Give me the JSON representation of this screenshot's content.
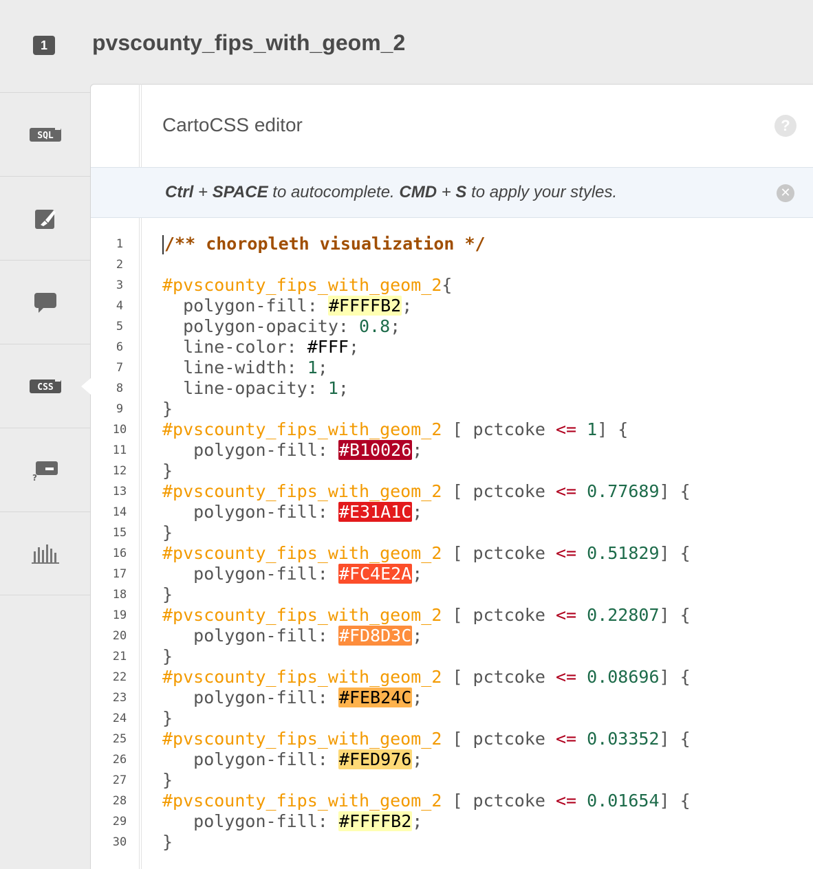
{
  "header": {
    "layer_number": "1",
    "layer_title": "pvscounty_fips_with_geom_2"
  },
  "sidebar": {
    "items": [
      {
        "name": "sql",
        "icon": "sql-icon",
        "label": "SQL"
      },
      {
        "name": "wizard",
        "icon": "paint-icon"
      },
      {
        "name": "infowindow",
        "icon": "speech-bubble-icon"
      },
      {
        "name": "css",
        "icon": "css-icon",
        "label": "CSS",
        "active": true
      },
      {
        "name": "legend",
        "icon": "legend-icon"
      },
      {
        "name": "filters",
        "icon": "bar-chart-icon"
      }
    ]
  },
  "editor": {
    "title": "CartoCSS editor",
    "hint": {
      "k1": "Ctrl",
      "plus1": " + ",
      "k2": "SPACE",
      "t1": " to autocomplete. ",
      "k3": "CMD",
      "plus2": " + ",
      "k4": "S",
      "t2": " to apply your styles."
    }
  },
  "code": {
    "selector": "#pvscounty_fips_with_geom_2",
    "comment": "/** choropleth visualization */",
    "base": {
      "fill": "#FFFFB2",
      "opacity": "0.8",
      "line_color": "#FFF",
      "line_width": "1",
      "line_opacity": "1"
    },
    "field": "pctcoke",
    "rules": [
      {
        "value": "1",
        "color": "#B10026"
      },
      {
        "value": "0.77689",
        "color": "#E31A1C"
      },
      {
        "value": "0.51829",
        "color": "#FC4E2A"
      },
      {
        "value": "0.22807",
        "color": "#FD8D3C"
      },
      {
        "value": "0.08696",
        "color": "#FEB24C"
      },
      {
        "value": "0.03352",
        "color": "#FED976"
      },
      {
        "value": "0.01654",
        "color": "#FFFFB2"
      }
    ]
  },
  "colors": {
    "sidebar_bg": "#ececec",
    "panel_bg": "#ffffff",
    "hint_bg": "#f2f6fb",
    "selector": "#f39a00",
    "comment": "#a04e00",
    "number": "#1d6b4a",
    "operator": "#b0001e"
  }
}
